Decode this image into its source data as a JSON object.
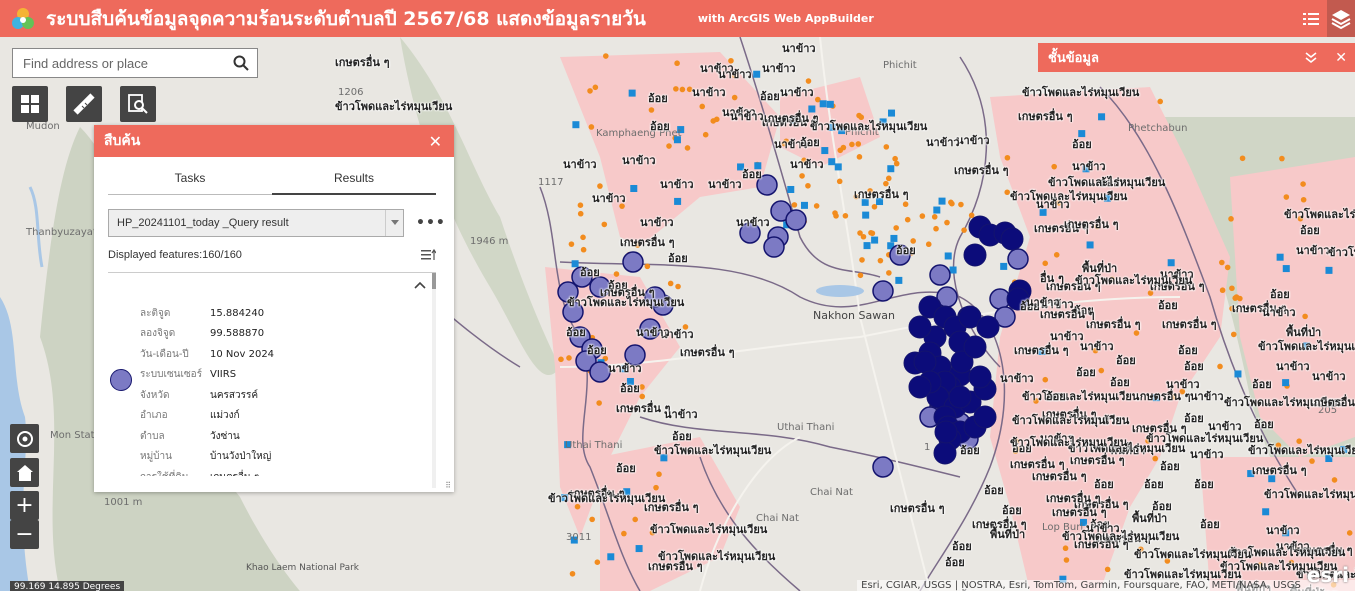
{
  "header": {
    "title": "ระบบสืบค้นข้อมูลจุดความร้อนระดับตำบลปี 2567/68 แสดงข้อมูลรายวัน",
    "subtitle": "with ArcGIS Web AppBuilder",
    "menu_icon": "list-icon",
    "layers_icon": "layers-icon"
  },
  "search": {
    "placeholder": "Find address or place"
  },
  "tools": [
    "grid-icon",
    "ruler-icon",
    "query-icon"
  ],
  "map": {
    "place_labels": [
      {
        "text": "Mudon",
        "cls": "place"
      },
      {
        "text": "Thanbyuzayat",
        "cls": "place"
      },
      {
        "text": "Mon State",
        "cls": "place"
      },
      {
        "text": "Kamphaeng Phet",
        "cls": "place"
      },
      {
        "text": "Phichit",
        "cls": "place"
      },
      {
        "text": "Phichit",
        "cls": "place"
      },
      {
        "text": "Phetchabun",
        "cls": "place"
      },
      {
        "text": "Nakhon Sawan",
        "cls": "city"
      },
      {
        "text": "Uthai Thani",
        "cls": "place"
      },
      {
        "text": "Uthai Thani",
        "cls": "place"
      },
      {
        "text": "Chai Nat",
        "cls": "place"
      },
      {
        "text": "Chai Nat",
        "cls": "place"
      },
      {
        "text": "Lop Buri",
        "cls": "place"
      },
      {
        "text": "1206",
        "cls": "place"
      },
      {
        "text": "1117",
        "cls": "place"
      },
      {
        "text": "3011",
        "cls": "place"
      },
      {
        "text": "205",
        "cls": "place"
      },
      {
        "text": "1",
        "cls": "place"
      },
      {
        "text": "1946 m",
        "cls": "place"
      },
      {
        "text": "1001 m",
        "cls": "place"
      },
      {
        "text": "Khao Laem National Park",
        "cls": "park"
      }
    ],
    "feature_labels": [
      "เกษตรอื่น ๆ",
      "ข้าวโพดและไร่หมุนเวียน",
      "นาข้าว",
      "นาข้าว",
      "นาข้าว",
      "อ้อย",
      "นาข้าว",
      "นาข้าว",
      "นาข้าว",
      "อ้อย",
      "นาข้าว",
      "เกษตรอื่น ๆ",
      "นาข้าว",
      "นาข้าว",
      "อ้อย",
      "เกษตรอื่น ๆ",
      "อ้อย",
      "นาข้าว",
      "นาข้าว",
      "นาข้าว",
      "ข้าวโพดและไร่หมุนเวียน",
      "นาข้าว",
      "นาข้าว",
      "อ้อย",
      "นาข้าว",
      "นาข้าว",
      "นาข้าว",
      "นาข้าว",
      "เกษตรอื่น ๆ",
      "อ้อย",
      "อ้อย",
      "อ้อย",
      "เกษตรอื่น ๆ",
      "นาข้าว",
      "เกษตรอื่น ๆ",
      "ข้าวโพดและไร่หมุนเวียน",
      "อ้อย",
      "นาข้าว",
      "อ้อย",
      "นาข้าว",
      "อ้อย",
      "เกษตรอื่น ๆ",
      "นาข้าว",
      "อ้อย",
      "ข้าวโพดและไร่หมุนเวียน",
      "อ้อย",
      "เกษตรอื่น ๆ",
      "ข้าวโพดและไร่หมุนเวียน",
      "ข้าวโพดและไร่หมุนเวียน",
      "เกษตรอื่น ๆ",
      "ข้าวโพดและไร่หมุนเวียน",
      "เกษตรอื่น ๆ",
      "นาข้าว",
      "เกษตรอื่น ๆ",
      "อ้อย",
      "เกษตรอื่น ๆ",
      "ข้าวโพดและไร่หมุนเวียน",
      "เกษตรอื่น ๆ",
      "ข้าวโพดและไร่หมุนเวียน",
      "เกษตรอื่น ๆ",
      "อ้อย",
      "นาข้าว",
      "พื้นที่ป่า",
      "อ้อย",
      "เกษตรอื่น ๆ",
      "เกษตรอื่น ๆ",
      "อ้อย",
      "ข้าวโพดและไร่หมุนเวียน",
      "นาข้าว",
      "เกษตรอื่น ๆ",
      "นาข้าว",
      "เกษตรอื่น ๆ",
      "อ้อย",
      "เกษตรอื่น ๆ",
      "นาข้าว",
      "นาข้าว",
      "อ้อย",
      "อ้อย",
      "อ้อย",
      "เกษตรอื่น ๆ",
      "อ้อย",
      "อ้อย",
      "นาข้าว",
      "ข้าวโพดและไร่หมุนเวียน",
      "นาข้าว",
      "เกษตรอื่น ๆ",
      "นาข้าว",
      "อ้อย",
      "เกษตรอื่น ๆ",
      "นาข้าว",
      "อ้อย",
      "ข้าวโพดและไร่หมุนเวียน",
      "พื้นที่ป่า",
      "อ้อย",
      "นาข้าว",
      "นาข้าว",
      "ข้าวโพดและไร่หมุนเวียน",
      "อ้อย",
      "เกษตรอื่น ๆ",
      "ข้าวโพดและไร่หมุนเวียน",
      "นาข้าว",
      "นาข้าว",
      "อ้อย",
      "นาข้าว",
      "ข้าวโพดและไร่หมุนเวียน",
      "พื้นที่ป่า",
      "เกษตรอื่น ๆ",
      "อ้อย",
      "นาข้าว",
      "เกษตรอื่น ๆ",
      "อ้อย",
      "เกษตรอื่น ๆ",
      "อ้อย",
      "เกษตรอื่น ๆ",
      "พื้นที่ป่า",
      "อ้อย",
      "อ้อย",
      "อ้อย",
      "เกษตรอื่น ๆ",
      "ข้าวโพดและไร่หมุนเวียน",
      "อ้อย",
      "นาข้าว",
      "เกษตรอื่น ๆ",
      "ข้าวโพดและไร่หมุนเวียน",
      "พื้นที่ป่า",
      "อ้อย",
      "นาข้าว",
      "ข้าวโพดและไร่หมุนเวียน",
      "ข้าวโพดและไร่หมุนเวียน",
      "พื้นที่ป่า",
      "ข้าวโพดและไร่หมุนเวียน",
      "อ้อย",
      "นาข้าว",
      "ข้าวโพดและไร่หมุนเวียน",
      "ข้าวโพดและไร่หมุนเวียน",
      "ข้าวโพดและไร่หมุนเวียน",
      "นาข้าว",
      "เกษตรอื่น ๆ",
      "เกษตรอื่น ๆ",
      "เกษตรอื่น ๆ",
      "ข้าวโพดและไร่หมุนเวียน",
      "เกษตรอื่น ๆ",
      "เกษตรอื่น ๆ",
      "อ้อย",
      "อ้อย",
      "อ้อย",
      "อ้อย",
      "เกษตรอื่น ๆ",
      "อ้อย",
      "พื้นที่ป่า",
      "อ้อย",
      "เกษตรอื่น ๆ",
      "อ้อย",
      "เกษตรอื่น ๆ",
      "นาข้าว",
      "อ้อย",
      "อื่น ๆ",
      "ข้าวโพดและไร่หมุนเวียน",
      "ข้าวโพดและไร่หมุนเวียน",
      "ข้าวโพดและไร่หมุนเวียน",
      "ข้าวโพดและไร่หมุนเวียน",
      "นาข้าว",
      "เกษตรอื่น ๆ",
      "พื้นที่ป่า",
      "อ้อย",
      "นาข้าว",
      "เกษตรอื่น ๆ",
      "อ้อย",
      "เกษตรอื่น ๆ",
      "อ้อย"
    ],
    "colors": {
      "land": "#e9e7e2",
      "zone": "#f7c9c9",
      "mountain": "#c9d0c0",
      "water": "#a9c7e6",
      "hotspot_fill": "#7c7ac4",
      "hotspot_stroke": "#14146e",
      "dense_hotspot": "#0c0c7a",
      "orange_point": "#f28c1e",
      "blue_point": "#1a8ad6",
      "accent": "#ee6a5c"
    }
  },
  "query_panel": {
    "title": "สืบค้น",
    "close_icon": "close-icon",
    "tabs": {
      "tasks": "Tasks",
      "results": "Results"
    },
    "selected_result": "HP_20241101_today _Query result",
    "more_label": "•••",
    "displayed_features": "Displayed features:160/160",
    "attributes": [
      {
        "key": "ละติจูด",
        "value": "15.884240"
      },
      {
        "key": "ลองจิจูด",
        "value": "99.588870"
      },
      {
        "key": "วัน-เดือน-ปี",
        "value": "10 Nov 2024"
      },
      {
        "key": "ระบบเซนเซอร์",
        "value": "VIIRS"
      },
      {
        "key": "จังหวัด",
        "value": "นครสวรรค์"
      },
      {
        "key": "อำเภอ",
        "value": "แม่วงก์"
      },
      {
        "key": "ตำบล",
        "value": "วังซ่าน"
      },
      {
        "key": "หมู่บ้าน",
        "value": "บ้านวังป่าใหญ่"
      },
      {
        "key": "การใช้ที่ดิน",
        "value": "เกษตรอื่น ๆ"
      }
    ]
  },
  "layer_panel": {
    "title": "ชั้นข้อมูล"
  },
  "controls": {
    "zoom_in": "+",
    "zoom_out": "−"
  },
  "coordinates": "99.169 14.895 Degrees",
  "attribution": "Esri, CGIAR, USGS | NOSTRA, Esri, TomTom, Garmin, Foursquare, FAO, METI/NASA, USGS",
  "esri_logo": "esri"
}
